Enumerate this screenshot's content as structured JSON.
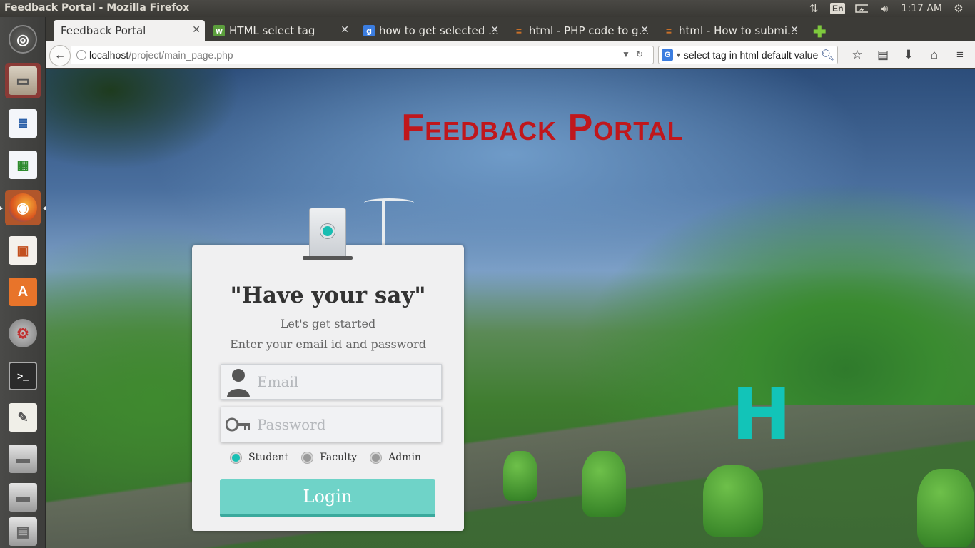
{
  "window": {
    "title": "Feedback Portal - Mozilla Firefox"
  },
  "tray": {
    "keyboard": "En",
    "clock": "1:17 AM"
  },
  "tabs": [
    {
      "label": "Feedback Portal",
      "favicon": "none"
    },
    {
      "label": "HTML select tag",
      "favicon": "w3c-icon"
    },
    {
      "label": "how to get selected …",
      "favicon": "google-icon"
    },
    {
      "label": "html - PHP code to g…",
      "favicon": "stackoverflow-icon"
    },
    {
      "label": "html - How to submi…",
      "favicon": "stackoverflow-icon"
    }
  ],
  "address": {
    "host": "localhost",
    "path": "/project/main_page.php"
  },
  "search": {
    "value": "select tag in html default value",
    "engine": "G"
  },
  "page": {
    "site_title": "Feedback Portal",
    "overlay_letter": "H",
    "card": {
      "heading": "\"Have your say\"",
      "subtitle": "Let's get started",
      "instruction": "Enter your email id and password",
      "email_placeholder": "Email",
      "password_placeholder": "Password",
      "roles": [
        {
          "label": "Student",
          "selected": true
        },
        {
          "label": "Faculty",
          "selected": false
        },
        {
          "label": "Admin",
          "selected": false
        }
      ],
      "login_label": "Login"
    }
  },
  "colors": {
    "title_red": "#c0171c",
    "accent_teal": "#19c0b4",
    "button_teal": "#6fd3c8"
  }
}
